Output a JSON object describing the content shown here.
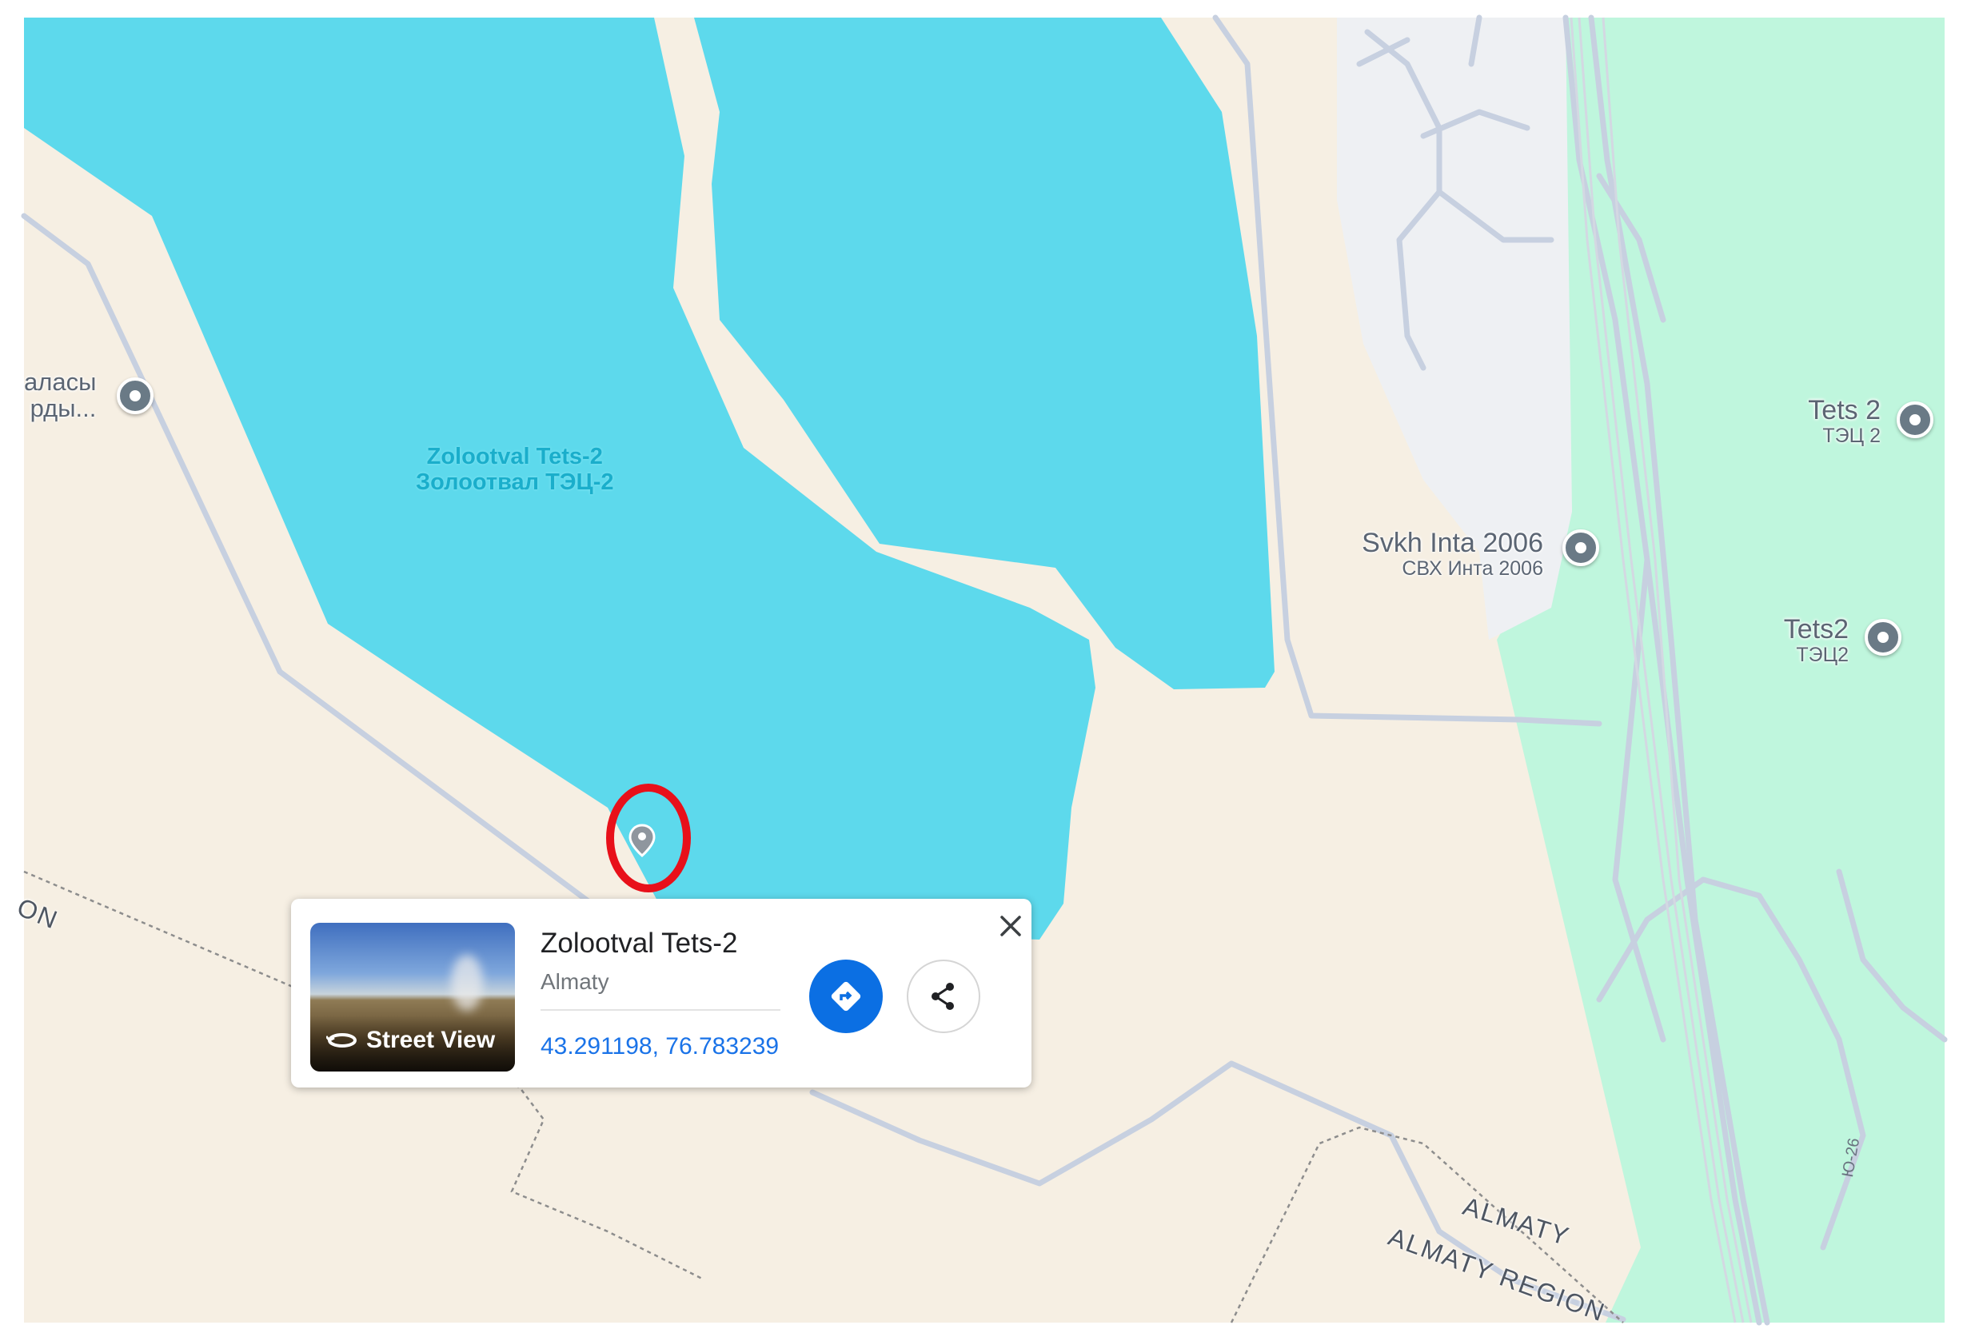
{
  "map": {
    "colors": {
      "land": "#f6efe3",
      "water": "#5dd9ec",
      "park": "#bff6dd",
      "industrial": "#eef0f3",
      "road": "#c7d0e0",
      "boundary": "#8d8d8d",
      "highlight": "#e8101a"
    },
    "water_label": {
      "line1": "Zolootval Tets-2",
      "line2": "Золоотвал ТЭЦ-2"
    },
    "pois": [
      {
        "name": "Tets 2",
        "subname": "ТЭЦ 2",
        "icon": "place-pin-icon"
      },
      {
        "name": "Svkh Inta 2006",
        "subname": "СВХ Инта 2006",
        "icon": "place-pin-icon"
      },
      {
        "name": "Tets2",
        "subname": "ТЭЦ2",
        "icon": "place-pin-icon"
      },
      {
        "name": "аласы",
        "subname": "рды...",
        "icon": "place-pin-icon"
      }
    ],
    "region_labels": {
      "city": "ALMATY",
      "region": "ALMATY REGION",
      "left_edge": "ON"
    },
    "road_number": "Ю-26"
  },
  "card": {
    "title": "Zolootval Tets-2",
    "subtitle": "Almaty",
    "coordinates": "43.291198, 76.783239",
    "street_view_label": "Street View",
    "icons": {
      "directions": "directions-icon",
      "share": "share-icon",
      "close": "close-icon",
      "street_view": "street-view-rotate-icon"
    }
  }
}
